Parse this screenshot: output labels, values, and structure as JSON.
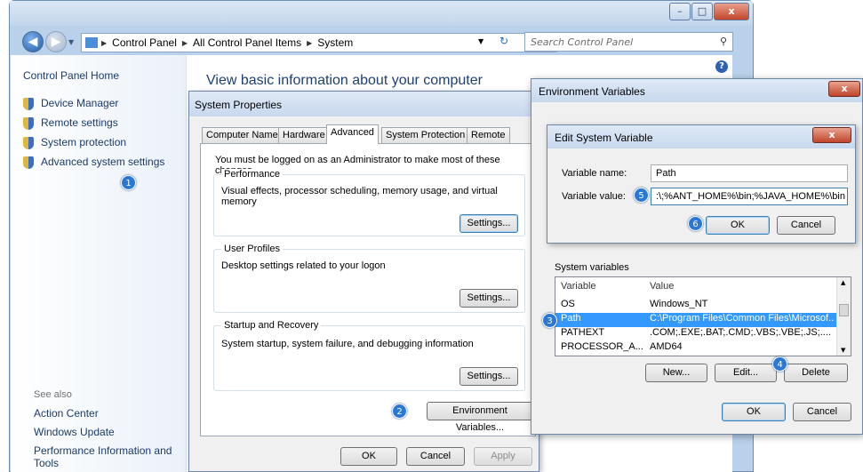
{
  "explorer": {
    "breadcrumb": [
      "Control Panel",
      "All Control Panel Items",
      "System"
    ],
    "search_placeholder": "Search Control Panel",
    "left_pane": {
      "home": "Control Panel Home",
      "links": [
        "Device Manager",
        "Remote settings",
        "System protection",
        "Advanced system settings"
      ],
      "see_also_heading": "See also",
      "see_also": [
        "Action Center",
        "Windows Update",
        "Performance Information and Tools"
      ]
    },
    "heading": "View basic information about your computer",
    "help_glyph": "?",
    "window_buttons": {
      "minimize": "–",
      "maximize": "□",
      "close": "x"
    }
  },
  "system_properties": {
    "title": "System Properties",
    "tabs": [
      "Computer Name",
      "Hardware",
      "Advanced",
      "System Protection",
      "Remote"
    ],
    "active_tab": "Advanced",
    "admin_notice": "You must be logged on as an Administrator to make most of these changes.",
    "groups": [
      {
        "legend": "Performance",
        "text": "Visual effects, processor scheduling, memory usage, and virtual memory",
        "button": "Settings..."
      },
      {
        "legend": "User Profiles",
        "text": "Desktop settings related to your logon",
        "button": "Settings..."
      },
      {
        "legend": "Startup and Recovery",
        "text": "System startup, system failure, and debugging information",
        "button": "Settings..."
      }
    ],
    "env_button": "Environment Variables...",
    "ok": "OK",
    "cancel": "Cancel",
    "apply": "Apply"
  },
  "environment_variables": {
    "title": "Environment Variables",
    "close_glyph": "x",
    "system_vars_label": "System variables",
    "columns": [
      "Variable",
      "Value"
    ],
    "rows": [
      {
        "name": "OS",
        "value": "Windows_NT"
      },
      {
        "name": "Path",
        "value": "C:\\Program Files\\Common Files\\Microsof...",
        "selected": true
      },
      {
        "name": "PATHEXT",
        "value": ".COM;.EXE;.BAT;.CMD;.VBS;.VBE;.JS;...."
      },
      {
        "name": "PROCESSOR_A...",
        "value": "AMD64"
      }
    ],
    "new": "New...",
    "edit": "Edit...",
    "delete": "Delete",
    "ok": "OK",
    "cancel": "Cancel"
  },
  "edit_system_variable": {
    "title": "Edit System Variable",
    "close_glyph": "x",
    "name_label": "Variable name:",
    "value_label": "Variable value:",
    "name_value": "Path",
    "value_value": ":\\;%ANT_HOME%\\bin;%JAVA_HOME%\\bin",
    "ok": "OK",
    "cancel": "Cancel"
  },
  "badges": [
    "1",
    "2",
    "3",
    "4",
    "5",
    "6"
  ],
  "colors": {
    "accent": "#2a78d6",
    "selection": "#3399ff",
    "link": "#1a3b6b"
  }
}
